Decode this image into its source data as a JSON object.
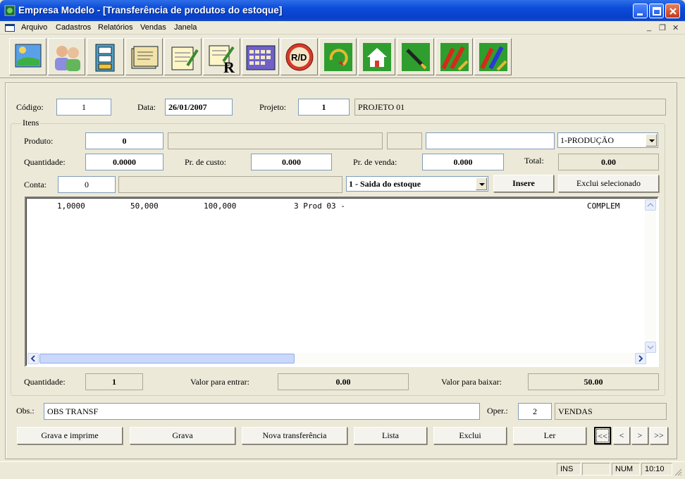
{
  "window": {
    "title": "Empresa Modelo - [Transferência de produtos do estoque]"
  },
  "menu": [
    "Arquivo",
    "Cadastros",
    "Relatórios",
    "Vendas",
    "Janela"
  ],
  "toolbar": [
    "map-icon",
    "people-icon",
    "cabinet-icon",
    "folders-icon",
    "notepad-icon",
    "notepad-r-icon",
    "calendar-icon",
    "rd-icon",
    "refresh-icon",
    "home-icon",
    "pen-icon",
    "chart-up-icon",
    "chart-up-blue-icon"
  ],
  "header": {
    "codigo_label": "Código:",
    "codigo": "1",
    "data_label": "Data:",
    "data": "26/01/2007",
    "projeto_label": "Projeto:",
    "projeto": "1",
    "projeto_nome": "PROJETO 01"
  },
  "itens": {
    "legend": "Itens",
    "produto_label": "Produto:",
    "produto": "0",
    "setor": "1-PRODUÇÃO",
    "quantidade_label": "Quantidade:",
    "quantidade": "0.0000",
    "custo_label": "Pr. de custo:",
    "custo": "0.000",
    "venda_label": "Pr. de venda:",
    "venda": "0.000",
    "total_label": "Total:",
    "total": "0.00",
    "conta_label": "Conta:",
    "conta": "0",
    "tipo": "1 - Saida do estoque",
    "insere": "Insere",
    "exclui_sel": "Exclui selecionado",
    "rows": [
      {
        "qtd": "1,0000",
        "custo": "50,000",
        "total": "100,000",
        "prod": "3 Prod 03 -",
        "obs": "COMPLEM"
      }
    ]
  },
  "totais": {
    "qtd_label": "Quantidade:",
    "qtd": "1",
    "entrar_label": "Valor para entrar:",
    "entrar": "0.00",
    "baixar_label": "Valor para baixar:",
    "baixar": "50.00"
  },
  "obs": {
    "label": "Obs.:",
    "value": "OBS TRANSF",
    "oper_label": "Oper.:",
    "oper": "2",
    "oper_nome": "VENDAS"
  },
  "buttons": {
    "grava_imprime": "Grava e imprime",
    "grava": "Grava",
    "nova": "Nova transferência",
    "lista": "Lista",
    "exclui": "Exclui",
    "ler": "Ler",
    "first": "<<",
    "prev": "<",
    "next": ">",
    "last": ">>"
  },
  "status": {
    "ins": "INS",
    "num": "NUM",
    "time": "10:10"
  }
}
